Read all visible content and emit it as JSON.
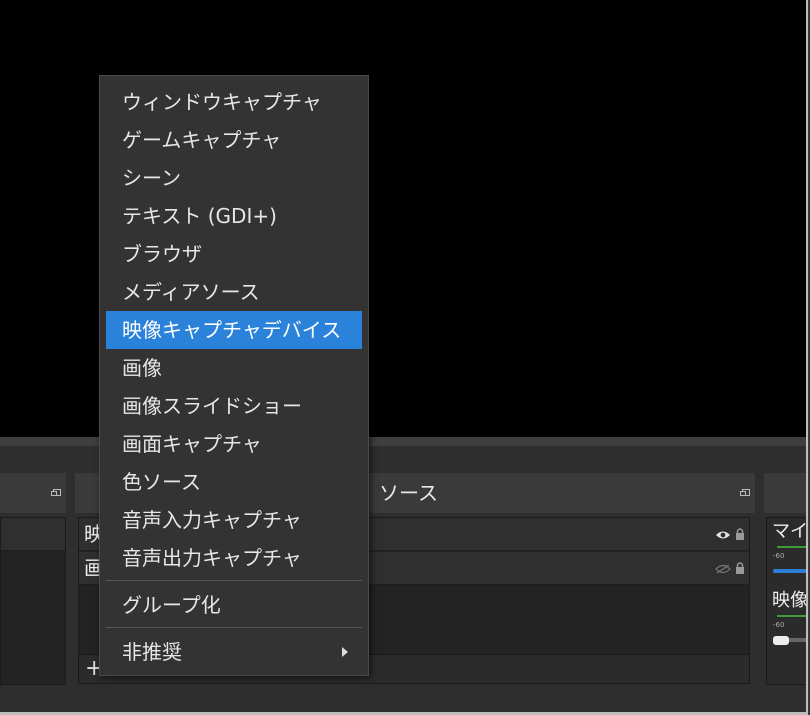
{
  "sources_dock": {
    "title": "ソース",
    "rows": [
      {
        "label": "映"
      },
      {
        "label": "画"
      }
    ],
    "add_label": "+"
  },
  "mixer_dock": {
    "channels": [
      {
        "label": "マイク",
        "scale": "-60",
        "fader_color": "#2e7ed6"
      },
      {
        "label": "映像",
        "scale": "-60",
        "fader_color": "#666666"
      }
    ]
  },
  "context_menu": {
    "items": [
      {
        "label": "ウィンドウキャプチャ"
      },
      {
        "label": "ゲームキャプチャ"
      },
      {
        "label": "シーン"
      },
      {
        "label": "テキスト (GDI+)"
      },
      {
        "label": "ブラウザ"
      },
      {
        "label": "メディアソース"
      },
      {
        "label": "映像キャプチャデバイス",
        "selected": true
      },
      {
        "label": "画像"
      },
      {
        "label": "画像スライドショー"
      },
      {
        "label": "画面キャプチャ"
      },
      {
        "label": "色ソース"
      },
      {
        "label": "音声入力キャプチャ"
      },
      {
        "label": "音声出力キャプチャ"
      }
    ],
    "group_label": "グループ化",
    "deprecated_label": "非推奨"
  },
  "colors": {
    "highlight": "#2a82da",
    "menu_bg": "#333333",
    "preview_bg": "#000000"
  }
}
